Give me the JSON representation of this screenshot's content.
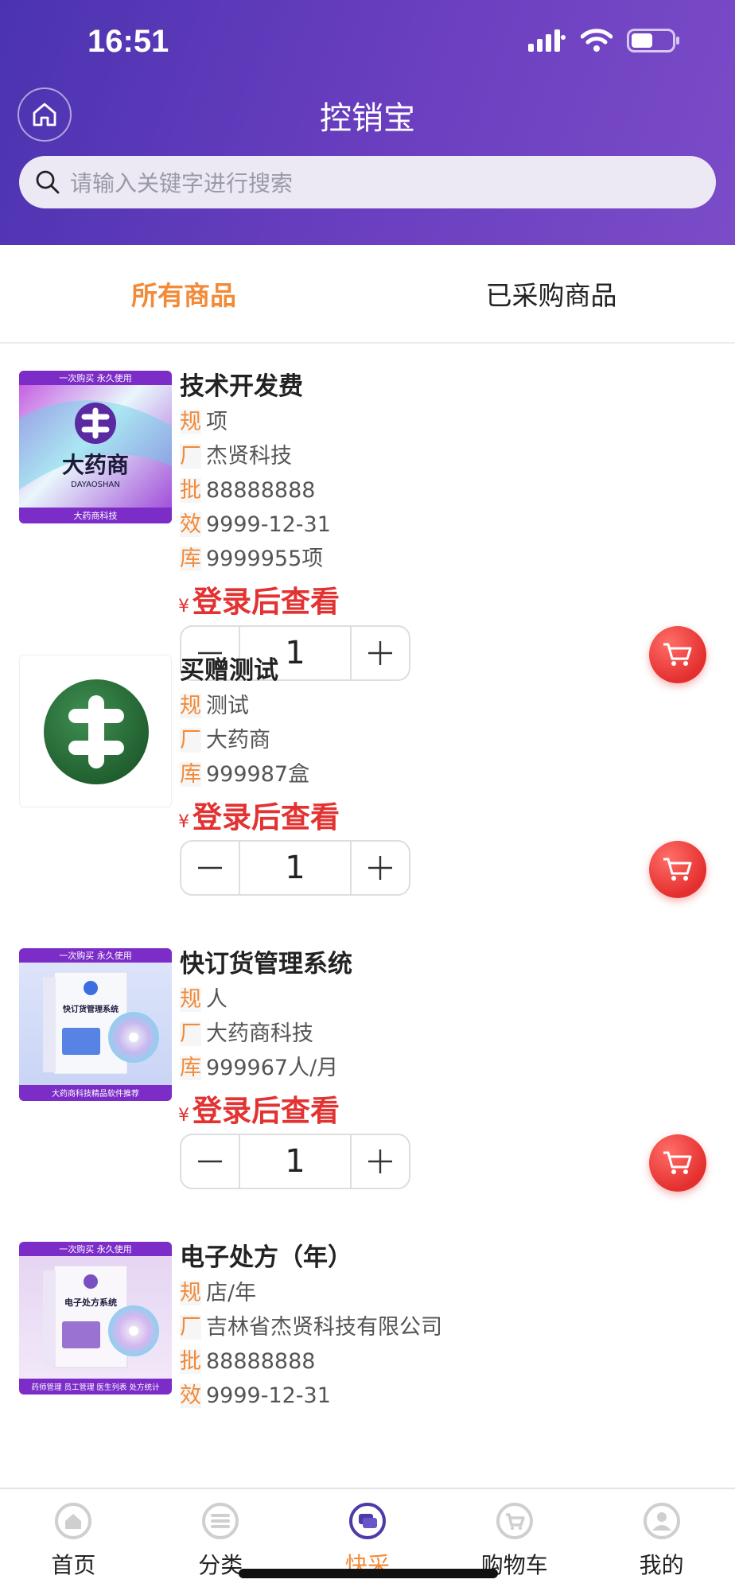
{
  "status_bar": {
    "time": "16:51"
  },
  "header": {
    "title": "控销宝",
    "search_placeholder": "请输入关键字进行搜索"
  },
  "tabs": [
    {
      "label": "所有商品",
      "active": true
    },
    {
      "label": "已采购商品",
      "active": false
    }
  ],
  "products": [
    {
      "name": "技术开发费",
      "thumb": {
        "banner": "一次购买 永久使用",
        "title": "大药商",
        "subtitle": "DAYAOSHAN",
        "footer": "大药商科技"
      },
      "attrs": [
        {
          "key": "规",
          "value": "项"
        },
        {
          "key": "厂",
          "value": "杰贤科技"
        },
        {
          "key": "批",
          "value": "88888888"
        },
        {
          "key": "效",
          "value": "9999-12-31"
        },
        {
          "key": "库",
          "value": "9999955项"
        }
      ],
      "price_symbol": "¥",
      "price_text": "登录后查看",
      "quantity": "1"
    },
    {
      "name": "买赠测试",
      "attrs": [
        {
          "key": "规",
          "value": "测试"
        },
        {
          "key": "厂",
          "value": "大药商"
        },
        {
          "key": "库",
          "value": "999987盒"
        }
      ],
      "price_symbol": "¥",
      "price_text": "登录后查看",
      "quantity": "1"
    },
    {
      "name": "快订货管理系统",
      "thumb": {
        "banner": "一次购买 永久使用",
        "title": "快订货管理系统",
        "footer": "大药商科技精品软件推荐"
      },
      "attrs": [
        {
          "key": "规",
          "value": "人"
        },
        {
          "key": "厂",
          "value": "大药商科技"
        },
        {
          "key": "库",
          "value": "999967人/月"
        }
      ],
      "price_symbol": "¥",
      "price_text": "登录后查看",
      "quantity": "1"
    },
    {
      "name": "电子处方（年）",
      "thumb": {
        "banner": "一次购买 永久使用",
        "title": "电子处方系统",
        "footer": "药师管理 员工管理 医生列表 处方统计"
      },
      "attrs": [
        {
          "key": "规",
          "value": "店/年"
        },
        {
          "key": "厂",
          "value": "吉林省杰贤科技有限公司"
        },
        {
          "key": "批",
          "value": "88888888"
        },
        {
          "key": "效",
          "value": "9999-12-31"
        }
      ]
    }
  ],
  "bottom_nav": [
    {
      "label": "首页",
      "icon": "home-icon",
      "active": false
    },
    {
      "label": "分类",
      "icon": "category-icon",
      "active": false
    },
    {
      "label": "快采",
      "icon": "quick-order-icon",
      "active": true
    },
    {
      "label": "购物车",
      "icon": "cart-icon",
      "active": false
    },
    {
      "label": "我的",
      "icon": "profile-icon",
      "active": false
    }
  ],
  "colors": {
    "header_start": "#4b33b0",
    "header_end": "#7b4cc8",
    "accent_orange": "#f28a38",
    "price_red": "#e23232",
    "cart_red": "#e42f2f"
  }
}
